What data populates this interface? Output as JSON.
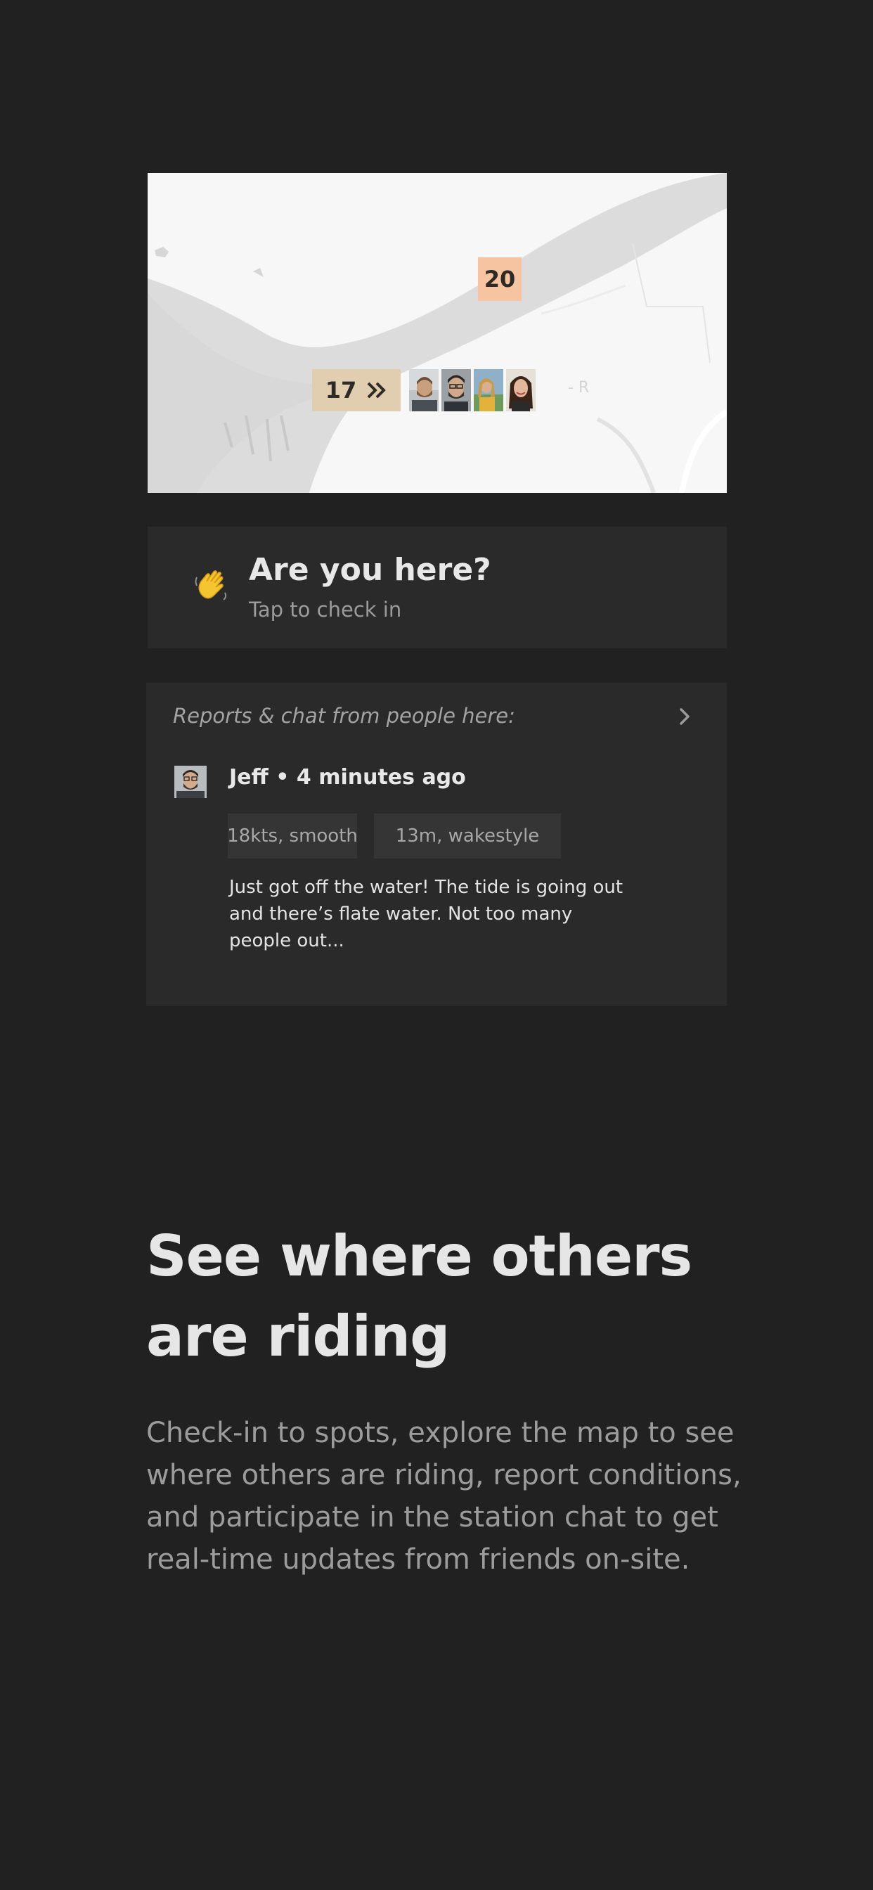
{
  "map": {
    "wind_badges": [
      {
        "value": "20",
        "color": "#f6c4a0"
      },
      {
        "value": "17",
        "color": "#e1cdb0",
        "icon": "double-chevron-right-icon"
      }
    ],
    "riders": [
      "rider-1",
      "rider-2",
      "rider-3",
      "rider-4"
    ],
    "trailing_label": "- R"
  },
  "checkin": {
    "icon": "waving-hand-icon",
    "title": "Are you here?",
    "subtitle": "Tap to check in"
  },
  "reports": {
    "title": "Reports & chat from people here:",
    "chevron_icon": "chevron-right-icon",
    "post": {
      "author": "Jeff",
      "meta": "Jeff • 4 minutes ago",
      "tags": [
        "18kts, smooth",
        "13m, wakestyle"
      ],
      "text": "Just got off the water! The tide is going out and there’s flate water. Not too many people out..."
    }
  },
  "feature": {
    "headline": "See where others are riding",
    "description": "Check-in to spots, explore the map to see where others are riding, report conditions, and participate in the station chat to get real-time updates from friends on-site."
  },
  "colors": {
    "background": "#212121",
    "card": "#2a2a2a",
    "tag": "#353535",
    "map_land": "#f7f7f7",
    "map_water": "#dcdcdc"
  }
}
